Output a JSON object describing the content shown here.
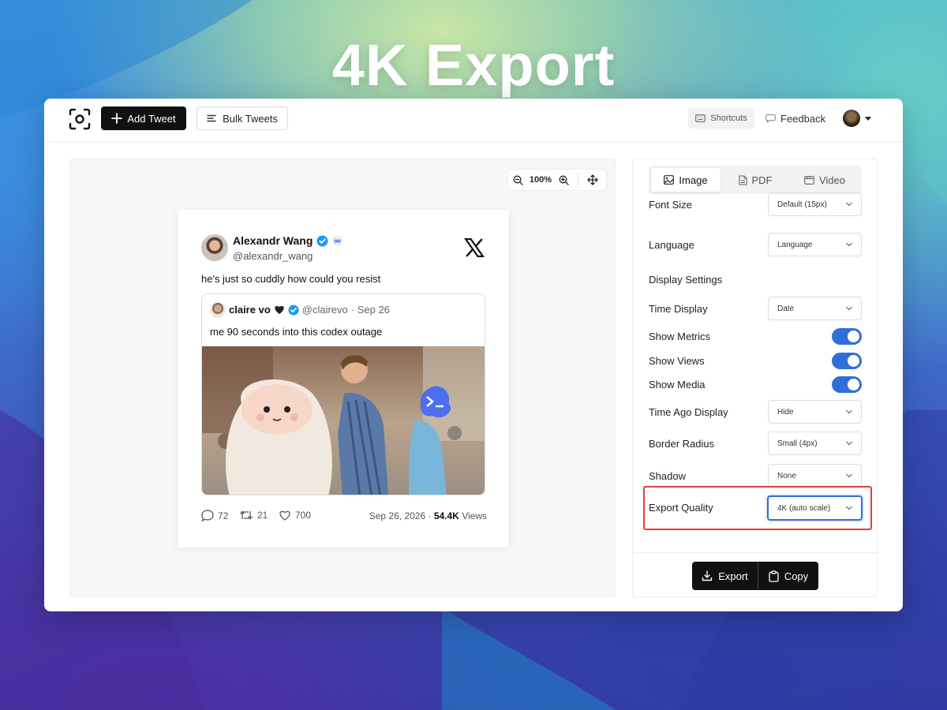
{
  "headline": "4K Export",
  "topbar": {
    "add_tweet_label": "Add Tweet",
    "bulk_tweets_label": "Bulk Tweets",
    "shortcuts_label": "Shortcuts",
    "feedback_label": "Feedback"
  },
  "canvas": {
    "zoom_level": "100%"
  },
  "tweet": {
    "author_name": "Alexandr Wang",
    "author_handle": "@alexandr_wang",
    "text": "he's just so cuddly how could you resist",
    "quote": {
      "author_name": "claire vo",
      "author_handle": "@clairevo",
      "date": "· Sep 26",
      "text": "me 90 seconds into this codex outage"
    },
    "metrics": {
      "replies": "72",
      "retweets": "21",
      "likes": "700"
    },
    "date": "Sep 26, 2026 ·",
    "views_count": "54.4K",
    "views_label": "Views"
  },
  "settings": {
    "tabs": [
      {
        "label": "Image",
        "icon": "image-icon",
        "active": true
      },
      {
        "label": "PDF",
        "icon": "document-icon",
        "active": false
      },
      {
        "label": "Video",
        "icon": "video-icon",
        "active": false
      }
    ],
    "font_size": {
      "label": "Font Size",
      "value": "Default (15px)"
    },
    "language": {
      "label": "Language",
      "value": "Language"
    },
    "display_settings_title": "Display Settings",
    "time_display": {
      "label": "Time Display",
      "value": "Date"
    },
    "show_metrics": {
      "label": "Show Metrics",
      "on": true
    },
    "show_views": {
      "label": "Show Views",
      "on": true
    },
    "show_media": {
      "label": "Show Media",
      "on": true
    },
    "time_ago_display": {
      "label": "Time Ago Display",
      "value": "Hide"
    },
    "border_radius": {
      "label": "Border Radius",
      "value": "Small (4px)"
    },
    "shadow": {
      "label": "Shadow",
      "value": "None"
    },
    "export_quality": {
      "label": "Export Quality",
      "value": "4K (auto scale)"
    },
    "export_label": "Export",
    "copy_label": "Copy"
  },
  "colors": {
    "accent": "#2f6fd8",
    "highlight_border": "#e0403e",
    "verified_badge": "#1d9bf0",
    "dark_button": "#111111"
  }
}
